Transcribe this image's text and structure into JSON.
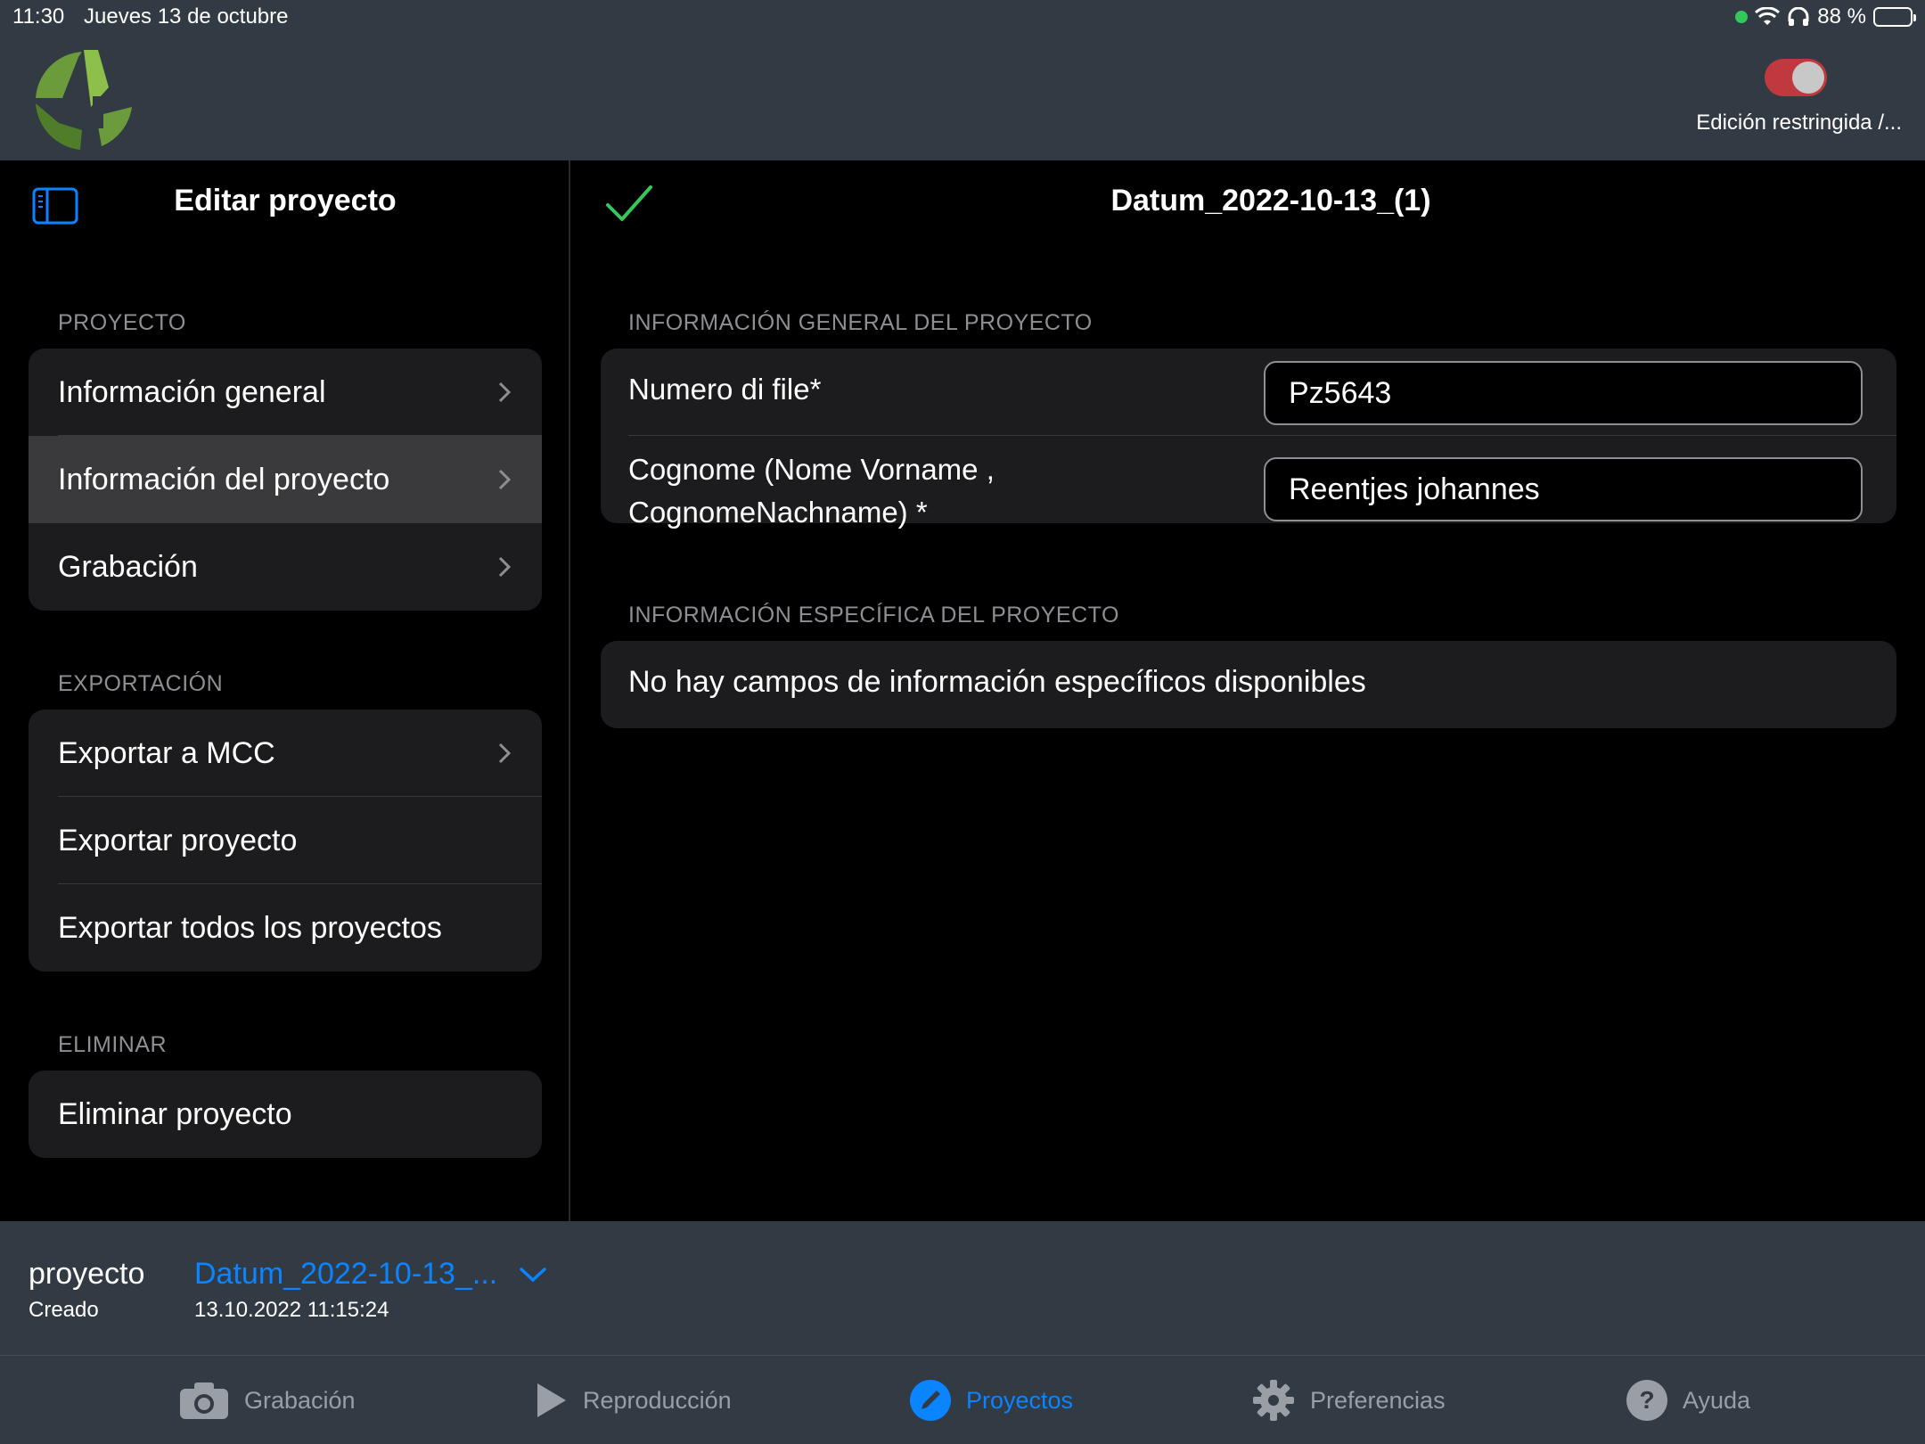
{
  "status_bar": {
    "time": "11:30",
    "date": "Jueves 13 de octubre",
    "battery": "88 %"
  },
  "header": {
    "toggle_label": "Edición restringida /..."
  },
  "sidebar": {
    "title": "Editar proyecto",
    "sections": {
      "proyecto": {
        "label": "PROYECTO",
        "items": [
          "Información general",
          "Información del proyecto",
          "Grabación"
        ]
      },
      "exportacion": {
        "label": "EXPORTACIÓN",
        "items": [
          "Exportar a MCC",
          "Exportar proyecto",
          "Exportar todos los proyectos"
        ]
      },
      "eliminar": {
        "label": "ELIMINAR",
        "items": [
          "Eliminar proyecto"
        ]
      }
    }
  },
  "detail": {
    "title": "Datum_2022-10-13_(1)",
    "general_section": "INFORMACIÓN GENERAL DEL PROYECTO",
    "fields": [
      {
        "label": "Numero di file*",
        "value": "Pz5643"
      },
      {
        "label_line1": "Cognome (Nome Vorname ,",
        "label_line2": "CognomeNachname) *",
        "value": "Reentjes johannes"
      }
    ],
    "specific_section": "INFORMACIÓN ESPECÍFICA DEL PROYECTO",
    "specific_empty": "No hay campos de información específicos disponibles"
  },
  "footer": {
    "label": "proyecto",
    "sub_label": "Creado",
    "project_name": "Datum_2022-10-13_...",
    "created": "13.10.2022 11:15:24"
  },
  "tabs": {
    "grabacion": "Grabación",
    "reproduccion": "Reproducción",
    "proyectos": "Proyectos",
    "preferencias": "Preferencias",
    "ayuda": "Ayuda"
  },
  "colors": {
    "accent": "#0a84ff",
    "toggle_on": "#c0393f",
    "check": "#34c759",
    "header_bg": "#323a44"
  }
}
